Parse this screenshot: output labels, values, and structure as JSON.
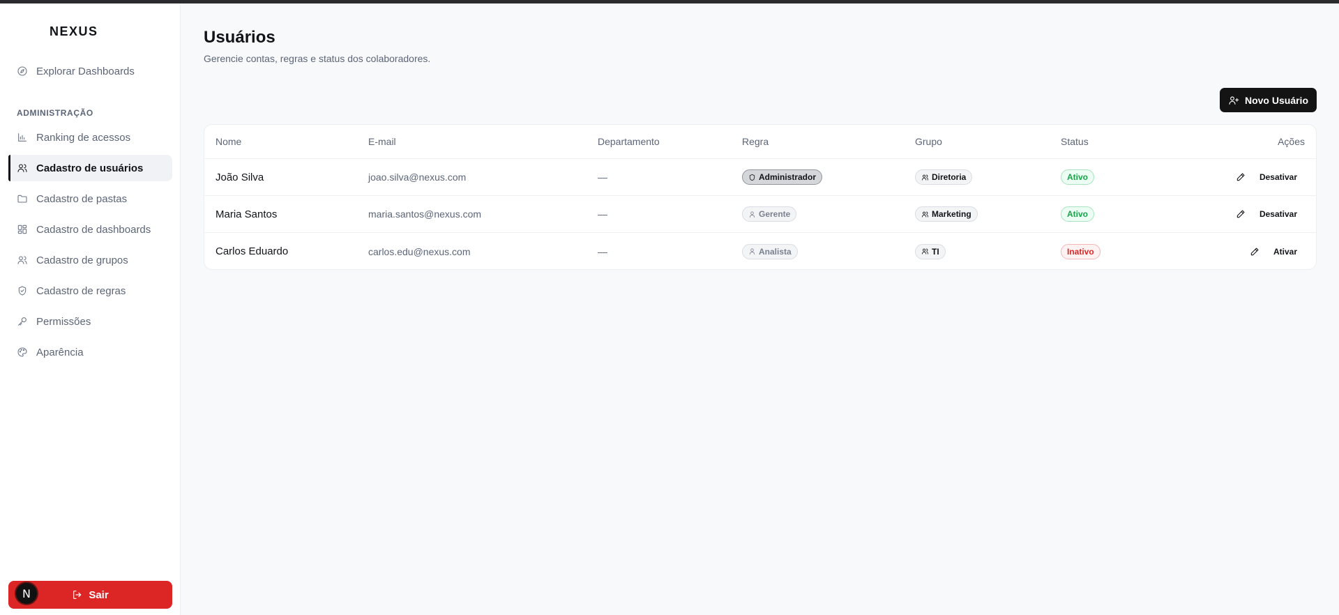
{
  "app": {
    "brand": "NEXUS"
  },
  "sidebar": {
    "explore": {
      "label": "Explorar Dashboards",
      "icon": "compass-icon"
    },
    "section_label": "ADMINISTRAÇÃO",
    "items": [
      {
        "label": "Ranking de acessos",
        "icon": "bar-chart-icon",
        "active": false
      },
      {
        "label": "Cadastro de usuários",
        "icon": "users-icon",
        "active": true
      },
      {
        "label": "Cadastro de pastas",
        "icon": "folder-icon",
        "active": false
      },
      {
        "label": "Cadastro de dashboards",
        "icon": "dashboard-grid-icon",
        "active": false
      },
      {
        "label": "Cadastro de grupos",
        "icon": "group-icon",
        "active": false
      },
      {
        "label": "Cadastro de regras",
        "icon": "shield-check-icon",
        "active": false
      },
      {
        "label": "Permissões",
        "icon": "key-icon",
        "active": false
      },
      {
        "label": "Aparência",
        "icon": "palette-icon",
        "active": false
      }
    ],
    "logout_label": "Sair",
    "avatar_letter": "N"
  },
  "main": {
    "title": "Usuários",
    "subtitle": "Gerencie contas, regras e status dos colaboradores.",
    "new_user_label": "Novo Usuário"
  },
  "table": {
    "headers": {
      "name": "Nome",
      "email": "E-mail",
      "dept": "Departamento",
      "rule": "Regra",
      "group": "Grupo",
      "status": "Status",
      "actions": "Ações"
    },
    "rows": [
      {
        "name": "João Silva",
        "email": "joao.silva@nexus.com",
        "dept": "—",
        "rule": "Administrador",
        "group": "Diretoria",
        "status": "Ativo",
        "action": "Desativar"
      },
      {
        "name": "Maria Santos",
        "email": "maria.santos@nexus.com",
        "dept": "—",
        "rule": "Gerente",
        "group": "Marketing",
        "status": "Ativo",
        "action": "Desativar"
      },
      {
        "name": "Carlos Eduardo",
        "email": "carlos.edu@nexus.com",
        "dept": "—",
        "rule": "Analista",
        "group": "TI",
        "status": "Inativo",
        "action": "Ativar"
      }
    ]
  },
  "colors": {
    "danger": "#dc2626",
    "success": "#16a34a",
    "primary": "#141414"
  }
}
